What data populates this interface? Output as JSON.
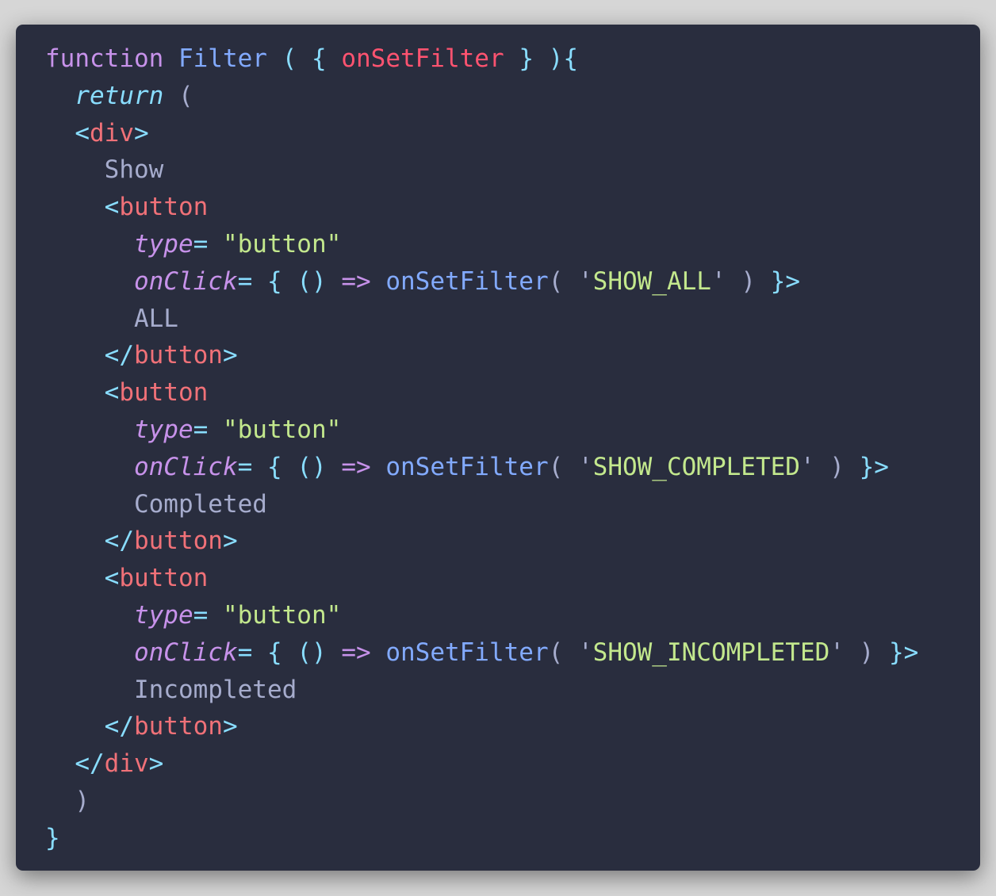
{
  "colors": {
    "background": "#d6d6d6",
    "editor_background": "#292d3e",
    "keyword": "#c792ea",
    "function": "#82aaff",
    "punctuation": "#89ddff",
    "parameter": "#ff5370",
    "tag": "#f07178",
    "string": "#c3e88d",
    "text": "#a6accd"
  },
  "code": {
    "lines": [
      {
        "tokens": [
          {
            "t": "function",
            "c": "keyword"
          },
          {
            "t": " ",
            "c": "text"
          },
          {
            "t": "Filter",
            "c": "fn"
          },
          {
            "t": " ",
            "c": "text"
          },
          {
            "t": "(",
            "c": "punct"
          },
          {
            "t": " ",
            "c": "text"
          },
          {
            "t": "{",
            "c": "punct"
          },
          {
            "t": " ",
            "c": "text"
          },
          {
            "t": "onSetFilter",
            "c": "param"
          },
          {
            "t": " ",
            "c": "text"
          },
          {
            "t": "}",
            "c": "punct"
          },
          {
            "t": " ",
            "c": "text"
          },
          {
            "t": "){",
            "c": "punct"
          }
        ]
      },
      {
        "tokens": [
          {
            "t": "  ",
            "c": "text"
          },
          {
            "t": "return",
            "c": "return"
          },
          {
            "t": " ",
            "c": "text"
          },
          {
            "t": "(",
            "c": "dim"
          }
        ]
      },
      {
        "tokens": [
          {
            "t": "  ",
            "c": "text"
          },
          {
            "t": "<",
            "c": "punct"
          },
          {
            "t": "div",
            "c": "tag"
          },
          {
            "t": ">",
            "c": "punct"
          }
        ]
      },
      {
        "tokens": [
          {
            "t": "    ",
            "c": "text"
          },
          {
            "t": "Show",
            "c": "text"
          }
        ]
      },
      {
        "tokens": [
          {
            "t": "    ",
            "c": "text"
          },
          {
            "t": "<",
            "c": "punct"
          },
          {
            "t": "button",
            "c": "tag"
          }
        ]
      },
      {
        "tokens": [
          {
            "t": "      ",
            "c": "text"
          },
          {
            "t": "type",
            "c": "attr"
          },
          {
            "t": "=",
            "c": "punct"
          },
          {
            "t": " ",
            "c": "text"
          },
          {
            "t": "\"button\"",
            "c": "string"
          }
        ]
      },
      {
        "tokens": [
          {
            "t": "      ",
            "c": "text"
          },
          {
            "t": "onClick",
            "c": "attr"
          },
          {
            "t": "=",
            "c": "punct"
          },
          {
            "t": " ",
            "c": "text"
          },
          {
            "t": "{",
            "c": "punct"
          },
          {
            "t": " ",
            "c": "text"
          },
          {
            "t": "()",
            "c": "punct"
          },
          {
            "t": " ",
            "c": "text"
          },
          {
            "t": "=>",
            "c": "keyword"
          },
          {
            "t": " ",
            "c": "text"
          },
          {
            "t": "onSetFilter",
            "c": "fn"
          },
          {
            "t": "(",
            "c": "dim"
          },
          {
            "t": " ",
            "c": "text"
          },
          {
            "t": "'",
            "c": "dim"
          },
          {
            "t": "SHOW_ALL",
            "c": "string"
          },
          {
            "t": "'",
            "c": "dim"
          },
          {
            "t": " ",
            "c": "text"
          },
          {
            "t": ")",
            "c": "dim"
          },
          {
            "t": " ",
            "c": "text"
          },
          {
            "t": "}>",
            "c": "punct"
          }
        ]
      },
      {
        "tokens": [
          {
            "t": "      ",
            "c": "text"
          },
          {
            "t": "ALL",
            "c": "text"
          }
        ]
      },
      {
        "tokens": [
          {
            "t": "    ",
            "c": "text"
          },
          {
            "t": "</",
            "c": "punct"
          },
          {
            "t": "button",
            "c": "tag"
          },
          {
            "t": ">",
            "c": "punct"
          }
        ]
      },
      {
        "tokens": [
          {
            "t": "    ",
            "c": "text"
          },
          {
            "t": "<",
            "c": "punct"
          },
          {
            "t": "button",
            "c": "tag"
          }
        ]
      },
      {
        "tokens": [
          {
            "t": "      ",
            "c": "text"
          },
          {
            "t": "type",
            "c": "attr"
          },
          {
            "t": "=",
            "c": "punct"
          },
          {
            "t": " ",
            "c": "text"
          },
          {
            "t": "\"button\"",
            "c": "string"
          }
        ]
      },
      {
        "tokens": [
          {
            "t": "      ",
            "c": "text"
          },
          {
            "t": "onClick",
            "c": "attr"
          },
          {
            "t": "=",
            "c": "punct"
          },
          {
            "t": " ",
            "c": "text"
          },
          {
            "t": "{",
            "c": "punct"
          },
          {
            "t": " ",
            "c": "text"
          },
          {
            "t": "()",
            "c": "punct"
          },
          {
            "t": " ",
            "c": "text"
          },
          {
            "t": "=>",
            "c": "keyword"
          },
          {
            "t": " ",
            "c": "text"
          },
          {
            "t": "onSetFilter",
            "c": "fn"
          },
          {
            "t": "(",
            "c": "dim"
          },
          {
            "t": " ",
            "c": "text"
          },
          {
            "t": "'",
            "c": "dim"
          },
          {
            "t": "SHOW_COMPLETED",
            "c": "string"
          },
          {
            "t": "'",
            "c": "dim"
          },
          {
            "t": " ",
            "c": "text"
          },
          {
            "t": ")",
            "c": "dim"
          },
          {
            "t": " ",
            "c": "text"
          },
          {
            "t": "}>",
            "c": "punct"
          }
        ]
      },
      {
        "tokens": [
          {
            "t": "      ",
            "c": "text"
          },
          {
            "t": "Completed",
            "c": "text"
          }
        ]
      },
      {
        "tokens": [
          {
            "t": "    ",
            "c": "text"
          },
          {
            "t": "</",
            "c": "punct"
          },
          {
            "t": "button",
            "c": "tag"
          },
          {
            "t": ">",
            "c": "punct"
          }
        ]
      },
      {
        "tokens": [
          {
            "t": "    ",
            "c": "text"
          },
          {
            "t": "<",
            "c": "punct"
          },
          {
            "t": "button",
            "c": "tag"
          }
        ]
      },
      {
        "tokens": [
          {
            "t": "      ",
            "c": "text"
          },
          {
            "t": "type",
            "c": "attr"
          },
          {
            "t": "=",
            "c": "punct"
          },
          {
            "t": " ",
            "c": "text"
          },
          {
            "t": "\"button\"",
            "c": "string"
          }
        ]
      },
      {
        "tokens": [
          {
            "t": "      ",
            "c": "text"
          },
          {
            "t": "onClick",
            "c": "attr"
          },
          {
            "t": "=",
            "c": "punct"
          },
          {
            "t": " ",
            "c": "text"
          },
          {
            "t": "{",
            "c": "punct"
          },
          {
            "t": " ",
            "c": "text"
          },
          {
            "t": "()",
            "c": "punct"
          },
          {
            "t": " ",
            "c": "text"
          },
          {
            "t": "=>",
            "c": "keyword"
          },
          {
            "t": " ",
            "c": "text"
          },
          {
            "t": "onSetFilter",
            "c": "fn"
          },
          {
            "t": "(",
            "c": "dim"
          },
          {
            "t": " ",
            "c": "text"
          },
          {
            "t": "'",
            "c": "dim"
          },
          {
            "t": "SHOW_INCOMPLETED",
            "c": "string"
          },
          {
            "t": "'",
            "c": "dim"
          },
          {
            "t": " ",
            "c": "text"
          },
          {
            "t": ")",
            "c": "dim"
          },
          {
            "t": " ",
            "c": "text"
          },
          {
            "t": "}>",
            "c": "punct"
          }
        ]
      },
      {
        "tokens": [
          {
            "t": "      ",
            "c": "text"
          },
          {
            "t": "Incompleted",
            "c": "text"
          }
        ]
      },
      {
        "tokens": [
          {
            "t": "    ",
            "c": "text"
          },
          {
            "t": "</",
            "c": "punct"
          },
          {
            "t": "button",
            "c": "tag"
          },
          {
            "t": ">",
            "c": "punct"
          }
        ]
      },
      {
        "tokens": [
          {
            "t": "  ",
            "c": "text"
          },
          {
            "t": "</",
            "c": "punct"
          },
          {
            "t": "div",
            "c": "tag"
          },
          {
            "t": ">",
            "c": "punct"
          }
        ]
      },
      {
        "tokens": [
          {
            "t": "  ",
            "c": "text"
          },
          {
            "t": ")",
            "c": "dim"
          }
        ]
      },
      {
        "tokens": [
          {
            "t": "}",
            "c": "punct"
          }
        ]
      }
    ]
  }
}
